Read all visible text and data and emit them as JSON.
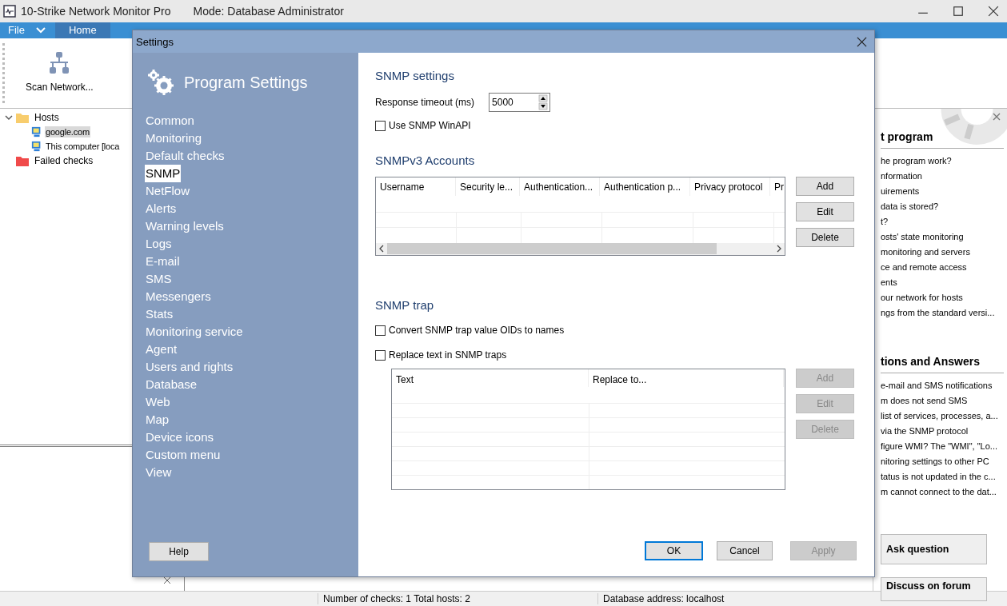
{
  "app": {
    "title": "10-Strike Network Monitor Pro",
    "mode": "Mode: Database Administrator",
    "menu": [
      {
        "label": "File",
        "selected": false
      },
      {
        "label": "Home",
        "selected": true
      }
    ],
    "ribbon": [
      {
        "label": "Scan Network..."
      }
    ],
    "tree": [
      {
        "label": "Hosts",
        "kind": "folder",
        "expanded": true,
        "selected": false,
        "children": [
          {
            "label": "google.com",
            "kind": "host",
            "selected": true
          },
          {
            "label": "This computer [loca",
            "kind": "host",
            "selected": false
          }
        ]
      },
      {
        "label": "Failed checks",
        "kind": "failed-folder",
        "selected": false
      }
    ],
    "help": {
      "sections": [
        {
          "title": "t program",
          "items": [
            "he program work?",
            "nformation",
            "uirements",
            "data is stored?",
            "t?",
            "osts' state monitoring",
            "monitoring and servers",
            "ce and remote access",
            "ents",
            "our network for hosts",
            "ngs from the standard versi..."
          ]
        },
        {
          "title": "tions and Answers",
          "items": [
            "e-mail and SMS notifications",
            "m does not send SMS",
            "list of services, processes, a...",
            "via the SNMP protocol",
            "figure WMI? The \"WMI\", \"Lo...",
            "nitoring settings to other PC",
            "tatus is not updated in the c...",
            "m cannot connect to the dat..."
          ]
        }
      ],
      "buttons": [
        "Ask question",
        "Discuss on forum"
      ]
    },
    "status": [
      "Number of checks: 1  Total hosts: 2",
      "Database address: localhost"
    ]
  },
  "dialog": {
    "title": "Settings",
    "header": "Program Settings",
    "nav": [
      {
        "label": "Common",
        "selected": false
      },
      {
        "label": "Monitoring",
        "selected": false
      },
      {
        "label": "Default checks",
        "selected": false
      },
      {
        "label": "SNMP",
        "selected": true
      },
      {
        "label": "NetFlow",
        "selected": false
      },
      {
        "label": "Alerts",
        "selected": false
      },
      {
        "label": "Warning levels",
        "selected": false
      },
      {
        "label": "Logs",
        "selected": false
      },
      {
        "label": "E-mail",
        "selected": false
      },
      {
        "label": "SMS",
        "selected": false
      },
      {
        "label": "Messengers",
        "selected": false
      },
      {
        "label": "Stats",
        "selected": false
      },
      {
        "label": "Monitoring service",
        "selected": false
      },
      {
        "label": "Agent",
        "selected": false
      },
      {
        "label": "Users and rights",
        "selected": false
      },
      {
        "label": "Database",
        "selected": false
      },
      {
        "label": "Web",
        "selected": false
      },
      {
        "label": "Map",
        "selected": false
      },
      {
        "label": "Device icons",
        "selected": false
      },
      {
        "label": "Custom menu",
        "selected": false
      },
      {
        "label": "View",
        "selected": false
      }
    ],
    "help_button": "Help",
    "snmp": {
      "title": "SNMP settings",
      "timeout_label": "Response timeout (ms)",
      "timeout": "5000",
      "winapi": {
        "label": "Use SNMP WinAPI",
        "checked": false
      }
    },
    "accounts": {
      "title": "SNMPv3 Accounts",
      "columns": [
        "Username",
        "Security le...",
        "Authentication...",
        "Authentication p...",
        "Privacy protocol",
        "Pr"
      ],
      "buttons": [
        {
          "label": "Add",
          "disabled": false
        },
        {
          "label": "Edit",
          "disabled": false
        },
        {
          "label": "Delete",
          "disabled": false
        }
      ]
    },
    "trap": {
      "title": "SNMP trap",
      "options": [
        {
          "label": "Convert SNMP trap value OIDs to names",
          "checked": false
        },
        {
          "label": "Replace text in SNMP traps",
          "checked": false
        }
      ],
      "columns": [
        "Text",
        "Replace to..."
      ],
      "buttons": [
        {
          "label": "Add",
          "disabled": true
        },
        {
          "label": "Edit",
          "disabled": true
        },
        {
          "label": "Delete",
          "disabled": true
        }
      ]
    },
    "footer": [
      {
        "label": "OK",
        "kind": "default",
        "disabled": false
      },
      {
        "label": "Cancel",
        "kind": "normal",
        "disabled": false
      },
      {
        "label": "Apply",
        "kind": "normal",
        "disabled": true
      }
    ]
  }
}
